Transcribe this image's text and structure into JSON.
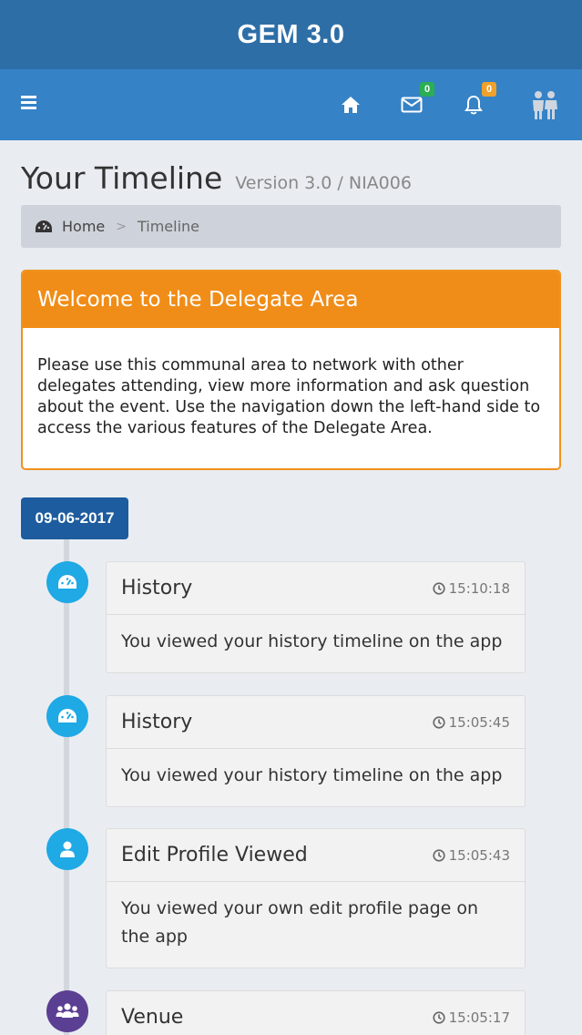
{
  "app": {
    "title": "GEM 3.0"
  },
  "nav": {
    "messages_count": "0",
    "notifications_count": "0"
  },
  "page": {
    "title": "Your Timeline",
    "subtitle": "Version 3.0 / NIA006"
  },
  "breadcrumb": {
    "home": "Home",
    "separator": ">",
    "current": "Timeline"
  },
  "welcome": {
    "heading": "Welcome to the Delegate Area",
    "body": "Please use this communal area to network with other delegates attending, view more information and ask question about the event. Use the navigation down the left-hand side to access the various features of the Delegate Area."
  },
  "timeline": {
    "date": "09-06-2017",
    "entries": [
      {
        "title": "History",
        "time": "15:10:18",
        "text": "You viewed your history timeline on the app",
        "icon": "dashboard-icon"
      },
      {
        "title": "History",
        "time": "15:05:45",
        "text": "You viewed your history timeline on the app",
        "icon": "dashboard-icon"
      },
      {
        "title": "Edit Profile Viewed",
        "time": "15:05:43",
        "text": "You viewed your own edit profile page on the app",
        "icon": "user-icon"
      },
      {
        "title": "Venue",
        "time": "15:05:17",
        "text": "",
        "icon": "group-icon"
      }
    ]
  },
  "colors": {
    "title_bar": "#2e6ea7",
    "nav_bar": "#3582c6",
    "welcome_accent": "#f08d18",
    "date_tag": "#1d5c9e",
    "bubble_blue": "#1fa9e5",
    "bubble_purple": "#5b3f93",
    "badge_green": "#2cae54",
    "badge_orange": "#f0a12b"
  }
}
